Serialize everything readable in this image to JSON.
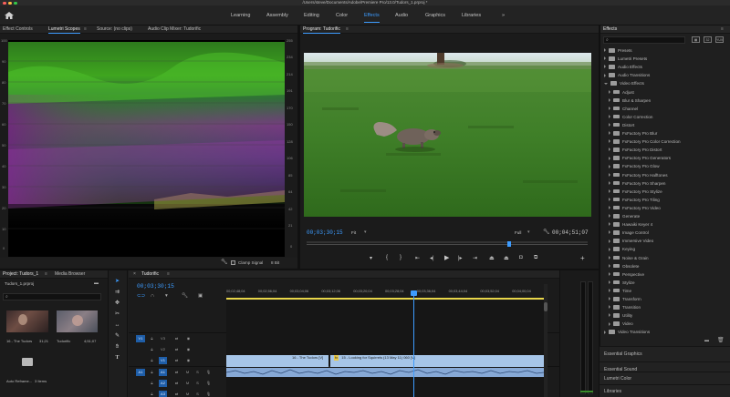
{
  "window": {
    "title": "/Users/steve/Documents/Adobe/Premiere Pro/13.0/Tudors_1.prproj *"
  },
  "workspaces": {
    "tabs": [
      "Learning",
      "Assembly",
      "Editing",
      "Color",
      "Effects",
      "Audio",
      "Graphics",
      "Libraries"
    ],
    "active": "Effects",
    "more": "»"
  },
  "top_panel": {
    "tabs": [
      "Effect Controls",
      "Lumetri Scopes",
      "Source: (no clips)",
      "Audio Clip Mixer: Tudorific"
    ],
    "scope_left_ticks": [
      "100",
      "90",
      "80",
      "70",
      "60",
      "50",
      "40",
      "30",
      "20",
      "10",
      "0"
    ],
    "scope_right_ticks": [
      "255",
      "234",
      "214",
      "191",
      "170",
      "150",
      "128",
      "106",
      "85",
      "64",
      "42",
      "21",
      "0"
    ],
    "clamp_signal": "Clamp Signal",
    "bit_depth": "8 Bit"
  },
  "program": {
    "title": "Program: Tudorific",
    "timecode": "00;03;30;15",
    "fit": "Fit",
    "quality": "Full",
    "duration": "00;04;51;07",
    "playhead_fraction": 0.72
  },
  "effects": {
    "title": "Effects",
    "items": [
      {
        "label": "Presets",
        "level": 0,
        "open": false
      },
      {
        "label": "Lumetri Presets",
        "level": 0,
        "open": false
      },
      {
        "label": "Audio Effects",
        "level": 0,
        "open": false
      },
      {
        "label": "Audio Transitions",
        "level": 0,
        "open": false
      },
      {
        "label": "Video Effects",
        "level": 0,
        "open": true
      },
      {
        "label": "Adjust",
        "level": 1,
        "open": false
      },
      {
        "label": "Blur & Sharpen",
        "level": 1,
        "open": false
      },
      {
        "label": "Channel",
        "level": 1,
        "open": false
      },
      {
        "label": "Color Correction",
        "level": 1,
        "open": false
      },
      {
        "label": "Distort",
        "level": 1,
        "open": false
      },
      {
        "label": "FxFactory Pro Blur",
        "level": 1,
        "open": false
      },
      {
        "label": "FxFactory Pro Color Correction",
        "level": 1,
        "open": false
      },
      {
        "label": "FxFactory Pro Distort",
        "level": 1,
        "open": false
      },
      {
        "label": "FxFactory Pro Generators",
        "level": 1,
        "open": false
      },
      {
        "label": "FxFactory Pro Glow",
        "level": 1,
        "open": false
      },
      {
        "label": "FxFactory Pro Halftones",
        "level": 1,
        "open": false
      },
      {
        "label": "FxFactory Pro Sharpen",
        "level": 1,
        "open": false
      },
      {
        "label": "FxFactory Pro Stylize",
        "level": 1,
        "open": false
      },
      {
        "label": "FxFactory Pro Tiling",
        "level": 1,
        "open": false
      },
      {
        "label": "FxFactory Pro Video",
        "level": 1,
        "open": false
      },
      {
        "label": "Generate",
        "level": 1,
        "open": false
      },
      {
        "label": "Hawaiki Keyer 4",
        "level": 1,
        "open": false
      },
      {
        "label": "Image Control",
        "level": 1,
        "open": false
      },
      {
        "label": "Immersive Video",
        "level": 1,
        "open": false
      },
      {
        "label": "Keying",
        "level": 1,
        "open": false
      },
      {
        "label": "Noise & Grain",
        "level": 1,
        "open": false
      },
      {
        "label": "Obsolete",
        "level": 1,
        "open": false
      },
      {
        "label": "Perspective",
        "level": 1,
        "open": false
      },
      {
        "label": "Stylize",
        "level": 1,
        "open": false
      },
      {
        "label": "Time",
        "level": 1,
        "open": false
      },
      {
        "label": "Transform",
        "level": 1,
        "open": false
      },
      {
        "label": "Transition",
        "level": 1,
        "open": false
      },
      {
        "label": "Utility",
        "level": 1,
        "open": false
      },
      {
        "label": "Video",
        "level": 1,
        "open": false
      },
      {
        "label": "Video Transitions",
        "level": 0,
        "open": false
      }
    ],
    "side_panels": [
      "Essential Graphics",
      "Essential Sound",
      "Lumetri Color",
      "Libraries"
    ]
  },
  "project": {
    "tabs": [
      "Project: Tudors_1",
      "Media Browser"
    ],
    "file": "Tudors_1.prproj",
    "clips": [
      {
        "name": "16 - The Tudors",
        "duration": "31;21"
      },
      {
        "name": "Tudorific",
        "duration": "4;51;07"
      }
    ],
    "auto_reframe": "Auto Reframe...",
    "items_count": "3 Items"
  },
  "timeline": {
    "title": "Tudorific",
    "timecode": "00;03;30;15",
    "ruler": [
      "00;02;48;04",
      "00;02;56;04",
      "00;03;04;06",
      "00;03;12;06",
      "00;03;20;04",
      "00;03;28;04",
      "00;03;36;04",
      "00;03;44;04",
      "00;03;52;04",
      "00;04;00;04"
    ],
    "video_tracks": [
      "V3",
      "V2",
      "V1"
    ],
    "audio_tracks": [
      "A1",
      "A2",
      "A3"
    ],
    "clip_v1a": "16 - The Tudors [V]",
    "clip_v1b": "15 - Looking for Squirrels (13 May 11) 060 [V]",
    "fx_label": "fx"
  },
  "colors": {
    "accent": "#3d9cff",
    "clip_video": "#a6c5e8",
    "clip_audio": "#87a9d6"
  }
}
